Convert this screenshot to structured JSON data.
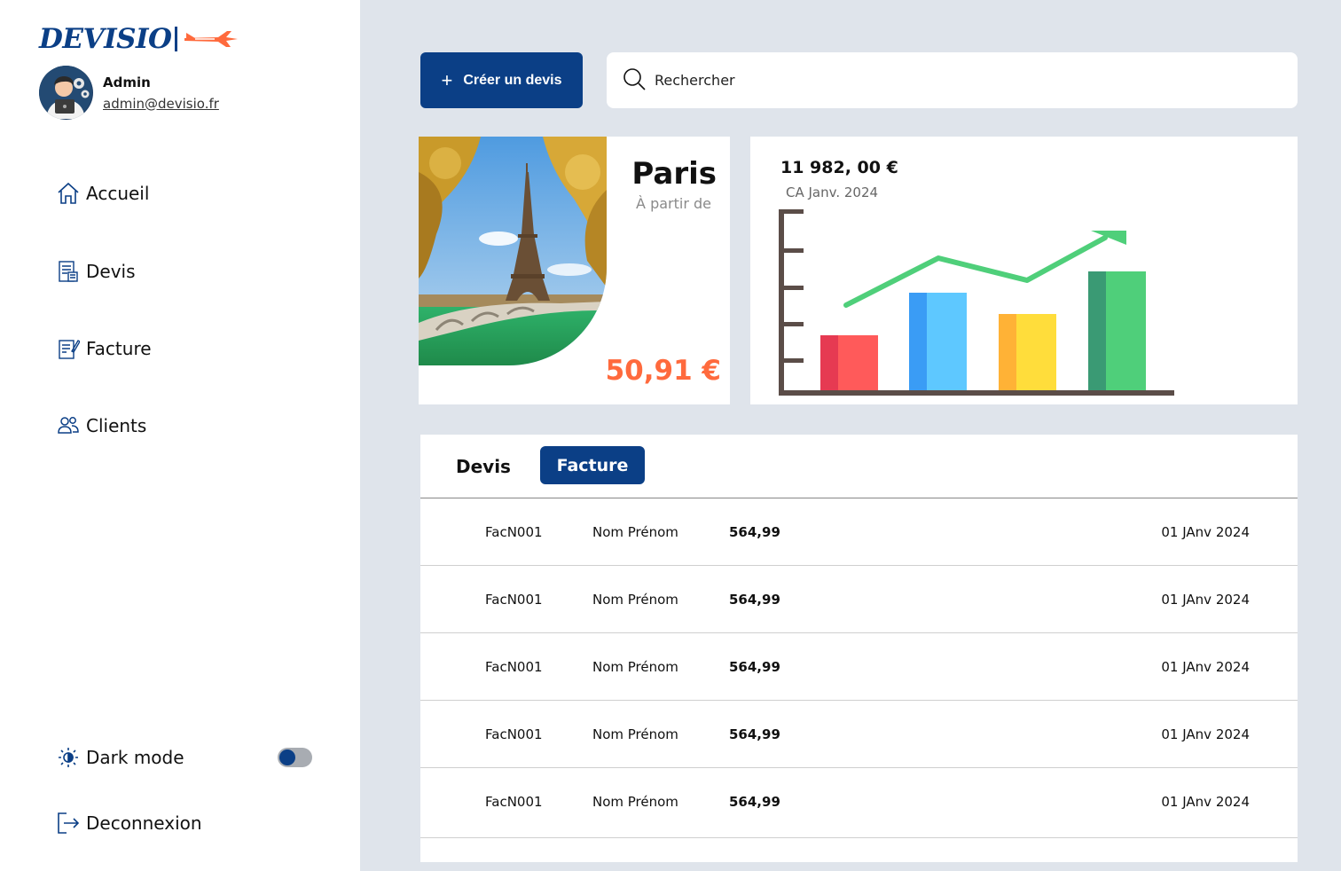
{
  "brand": {
    "name": "DEVISIO",
    "accent": "#ff6a3d",
    "primary": "#0b3f86"
  },
  "user": {
    "name": "Admin",
    "email": "admin@devisio.fr"
  },
  "nav": {
    "items": [
      {
        "label": "Accueil",
        "icon": "home-icon"
      },
      {
        "label": "Devis",
        "icon": "quote-document-icon"
      },
      {
        "label": "Facture",
        "icon": "invoice-icon"
      },
      {
        "label": "Clients",
        "icon": "users-icon"
      }
    ],
    "dark_mode_label": "Dark mode",
    "dark_mode_enabled": false,
    "logout_label": "Deconnexion"
  },
  "toolbar": {
    "create_label": "Créer un devis",
    "search_placeholder": "Rechercher"
  },
  "promo": {
    "city": "Paris",
    "subtitle": "À partir de",
    "price": "50,91 €"
  },
  "stats": {
    "value": "11 982, 00 €",
    "label": "CA Janv. 2024"
  },
  "tabs": {
    "devis_label": "Devis",
    "facture_label": "Facture",
    "active": "Facture"
  },
  "rows": [
    {
      "id": "FacN001",
      "name": "Nom Prénom",
      "amount": "564,99",
      "date": "01 JAnv 2024"
    },
    {
      "id": "FacN001",
      "name": "Nom Prénom",
      "amount": "564,99",
      "date": "01 JAnv 2024"
    },
    {
      "id": "FacN001",
      "name": "Nom Prénom",
      "amount": "564,99",
      "date": "01 JAnv 2024"
    },
    {
      "id": "FacN001",
      "name": "Nom Prénom",
      "amount": "564,99",
      "date": "01 JAnv 2024"
    },
    {
      "id": "FacN001",
      "name": "Nom Prénom",
      "amount": "564,99",
      "date": "01 JAnv 2024"
    }
  ]
}
